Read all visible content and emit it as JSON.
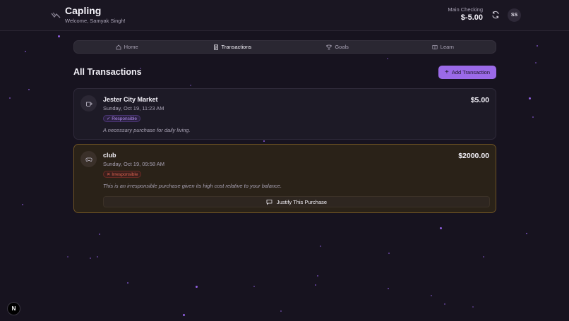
{
  "header": {
    "app_title": "Capling",
    "welcome": "Welcome, Samyak Singh!",
    "account_label": "Main Checking",
    "account_balance": "$-5.00",
    "avatar_initials": "SS"
  },
  "nav": {
    "tabs": [
      {
        "label": "Home",
        "icon": "home-icon",
        "active": false
      },
      {
        "label": "Transactions",
        "icon": "receipt-icon",
        "active": true
      },
      {
        "label": "Goals",
        "icon": "trophy-icon",
        "active": false
      },
      {
        "label": "Learn",
        "icon": "book-icon",
        "active": false
      }
    ]
  },
  "main": {
    "title": "All Transactions",
    "add_button_label": "Add Transaction",
    "transactions": [
      {
        "name": "Jester City Market",
        "date": "Sunday, Oct 19, 11:23 AM",
        "amount": "$5.00",
        "badge": "✓ Responsible",
        "note": "A necessary purchase for daily living.",
        "icon": "coffee-icon"
      },
      {
        "name": "club",
        "date": "Sunday, Oct 19, 09:58 AM",
        "amount": "$2000.00",
        "badge": "✕ Irresponsible",
        "note": "This is an irresponsible purchase given its high cost relative to your balance.",
        "icon": "gamepad-icon",
        "action_label": "Justify This Purchase"
      }
    ]
  },
  "corner_badge": "N",
  "colors": {
    "background": "#17131f",
    "accent": "#9b6ae8",
    "responsible": "#b38cf0",
    "irresponsible": "#e0634f",
    "warning_border": "#6d5224"
  }
}
